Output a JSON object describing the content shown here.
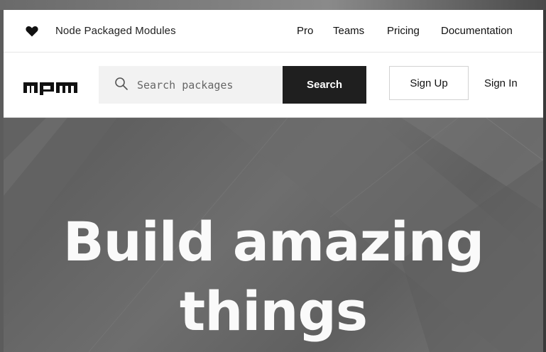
{
  "topbar": {
    "icon": "heart-icon",
    "brand_name": "Node Packaged Modules",
    "nav": [
      "Pro",
      "Teams",
      "Pricing",
      "Documentation"
    ]
  },
  "searchrow": {
    "logo": "npm",
    "search_placeholder": "Search packages",
    "search_value": "",
    "search_button": "Search",
    "signup": "Sign Up",
    "signin": "Sign In"
  },
  "hero": {
    "title_line1": "Build amazing",
    "title_line2": "things"
  },
  "colors": {
    "search_button_bg": "#1f1f1f",
    "search_box_bg": "#f2f2f2",
    "hero_bg": "#666666",
    "hero_text": "#fafafa"
  }
}
